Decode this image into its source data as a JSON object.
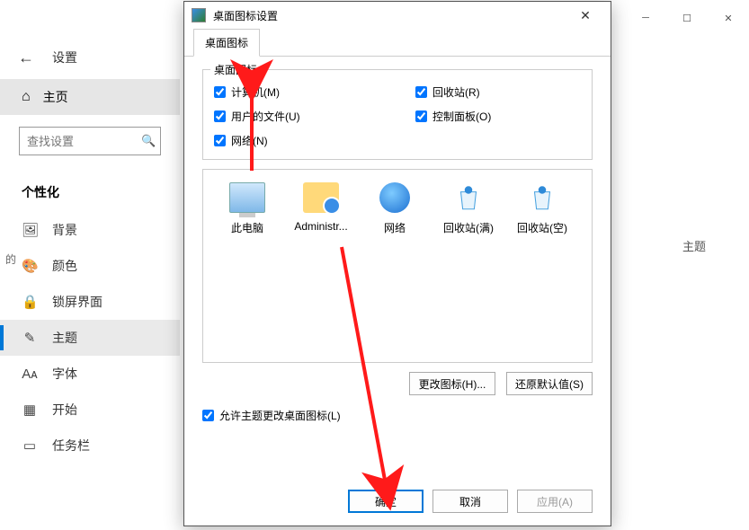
{
  "settings": {
    "header_title": "设置",
    "home_label": "主页",
    "search_placeholder": "查找设置",
    "section_label": "个性化",
    "nav": [
      {
        "icon": "🖼",
        "label": "背景"
      },
      {
        "icon": "🎨",
        "label": "颜色"
      },
      {
        "icon": "🔒",
        "label": "锁屏界面"
      },
      {
        "icon": "✎",
        "label": "主题"
      },
      {
        "icon": "Aᴀ",
        "label": "字体"
      },
      {
        "icon": "▦",
        "label": "开始"
      },
      {
        "icon": "▭",
        "label": "任务栏"
      }
    ],
    "right_hint_suffix": "主题",
    "left_edge": "的"
  },
  "dialog": {
    "title": "桌面图标设置",
    "tab": "桌面图标",
    "group_legend": "桌面图标",
    "checks": {
      "computer": "计算机(M)",
      "recycle": "回收站(R)",
      "userfiles": "用户的文件(U)",
      "ctrlpanel": "控制面板(O)",
      "network": "网络(N)"
    },
    "icons": {
      "pc": "此电脑",
      "user": "Administr...",
      "net": "网络",
      "bin_full": "回收站(满)",
      "bin_empty": "回收站(空)"
    },
    "btn_change": "更改图标(H)...",
    "btn_restore": "还原默认值(S)",
    "allow_themes": "允许主题更改桌面图标(L)",
    "ok": "确定",
    "cancel": "取消",
    "apply": "应用(A)"
  }
}
